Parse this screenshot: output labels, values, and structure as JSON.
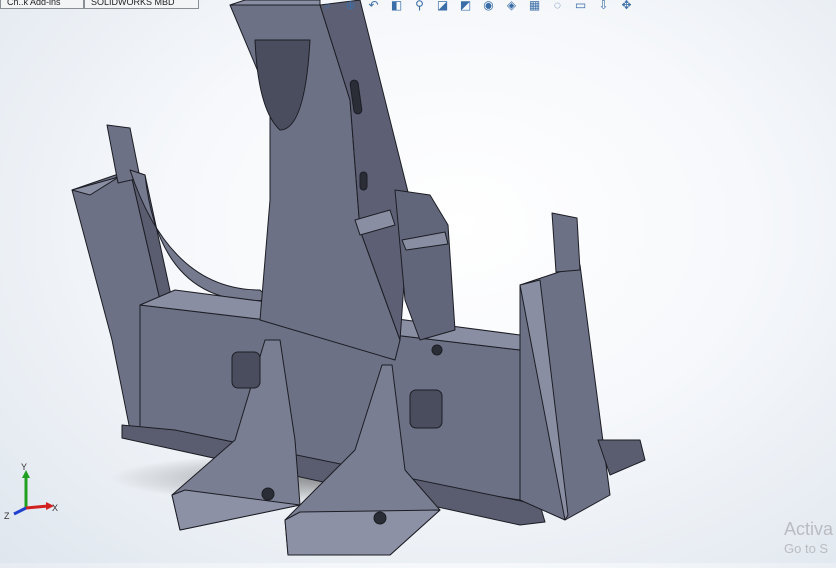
{
  "tabs": [
    {
      "label": "Ch..k Add-ins"
    },
    {
      "label": "SOLIDWORKS MBD"
    }
  ],
  "heads_up_toolbar": [
    {
      "icon": "zoom-to-fit-icon",
      "glyph": "⌕"
    },
    {
      "icon": "zoom-to-area-icon",
      "glyph": "⊕"
    },
    {
      "icon": "previous-view-icon",
      "glyph": "↶"
    },
    {
      "icon": "section-view-icon",
      "glyph": "◧"
    },
    {
      "icon": "dynamic-annotation-views-icon",
      "glyph": "⚲"
    },
    {
      "icon": "view-orientation-icon",
      "glyph": "◪"
    },
    {
      "icon": "display-style-icon",
      "glyph": "◩"
    },
    {
      "icon": "hide-show-items-icon",
      "glyph": "◉"
    },
    {
      "icon": "edit-appearance-icon",
      "glyph": "◈"
    },
    {
      "icon": "apply-scene-icon",
      "glyph": "▦"
    },
    {
      "icon": "view-settings-icon",
      "glyph": "◌"
    },
    {
      "icon": "display-monitor-icon",
      "glyph": "▭"
    },
    {
      "icon": "view-orientation-front-icon",
      "glyph": "⇩"
    },
    {
      "icon": "pan-rotate-icon",
      "glyph": "✥"
    }
  ],
  "triad": {
    "x_label": "X",
    "y_label": "Y",
    "z_label": "Z",
    "x_color": "#d02020",
    "y_color": "#20a020",
    "z_color": "#2040d0"
  },
  "watermark": {
    "line1": "Activa",
    "line2": "Go to S"
  },
  "colors": {
    "model_face": "#6d7186",
    "model_light": "#8a8ea3",
    "model_dark": "#4a4d5e",
    "edge": "#1c1d24"
  }
}
